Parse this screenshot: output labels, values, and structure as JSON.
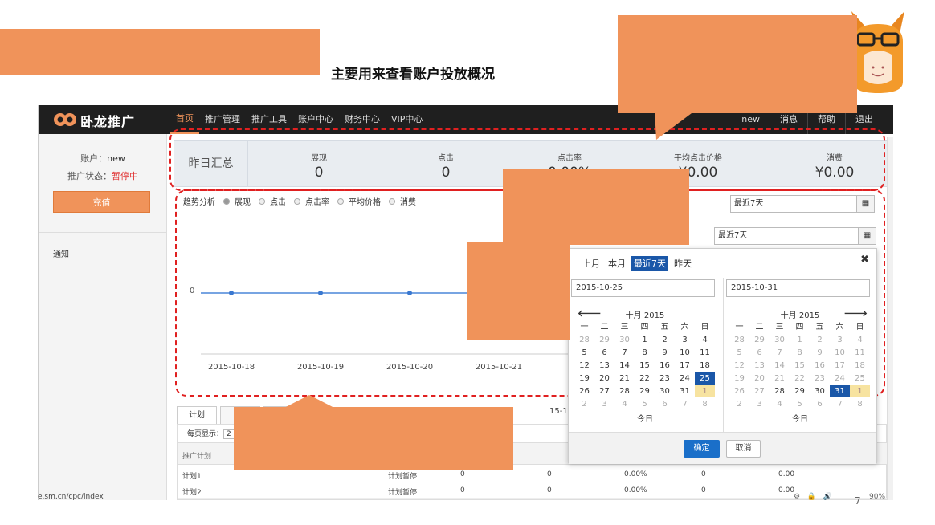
{
  "slide": {
    "title": "主要用来查看账户投放概况",
    "page_number": "7"
  },
  "header": {
    "brand": "卧龙推广",
    "domain": "e.sm.cn",
    "nav": [
      "首页",
      "推广管理",
      "推广工具",
      "账户中心",
      "财务中心",
      "VIP中心"
    ],
    "active_nav": "首页",
    "right_nav": [
      "new",
      "消息",
      "帮助",
      "退出"
    ]
  },
  "sidebar": {
    "account_label": "账户：",
    "account_value": "new",
    "status_label": "推广状态：",
    "status_value": "暂停中",
    "recharge_button": "充值",
    "notice": "通知"
  },
  "summary": {
    "title": "昨日汇总",
    "metrics": [
      {
        "label": "展现",
        "value": "0"
      },
      {
        "label": "点击",
        "value": "0"
      },
      {
        "label": "点击率",
        "value": "0.00%"
      },
      {
        "label": "平均点击价格",
        "value": "¥0.00"
      },
      {
        "label": "消费",
        "value": "¥0.00"
      }
    ]
  },
  "trend": {
    "title": "趋势分析",
    "options": [
      "展现",
      "点击",
      "点击率",
      "平均价格",
      "消费"
    ],
    "selected": "展现",
    "range_select": "最近7天",
    "range_select_2": "最近7天"
  },
  "chart_data": {
    "type": "line",
    "categories": [
      "2015-10-18",
      "2015-10-19",
      "2015-10-20",
      "2015-10-21"
    ],
    "series": [
      {
        "values": [
          0,
          0,
          0,
          0
        ]
      }
    ],
    "ytick": "0",
    "xtick_fragment": "15-1",
    "grid": false,
    "title": "",
    "xlabel": "",
    "ylabel": ""
  },
  "table": {
    "tab": "计划",
    "per_page_label": "每页显示：",
    "per_page_value": "2",
    "col_header": "推广计划",
    "rows": [
      {
        "name": "计划1",
        "status": "计划暂停",
        "c3": "0",
        "c4": "0",
        "c5": "0.00%",
        "c6": "0",
        "c7": "0.00"
      },
      {
        "name": "计划2",
        "status": "计划暂停",
        "c3": "0",
        "c4": "0",
        "c5": "0.00%",
        "c6": "0",
        "c7": "0.00"
      }
    ]
  },
  "datepicker": {
    "quick": [
      "上月",
      "本月",
      "最近7天",
      "昨天"
    ],
    "quick_selected": "最近7天",
    "close": "✖",
    "start": "2015-10-25",
    "end": "2015-10-31",
    "left_month": "十月 2015",
    "right_month": "十月 2015",
    "weekdays": [
      "一",
      "二",
      "三",
      "四",
      "五",
      "六",
      "日"
    ],
    "today": "今日",
    "ok": "确定",
    "cancel": "取消",
    "prev_arrow": "🡐",
    "next_arrow": "🡒"
  },
  "statusbar": {
    "url": "e.sm.cn/cpc/index",
    "zoom": "90%"
  },
  "colors": {
    "accent": "#f0935a",
    "dash": "#e02020",
    "selected_day": "#1a57a8"
  }
}
